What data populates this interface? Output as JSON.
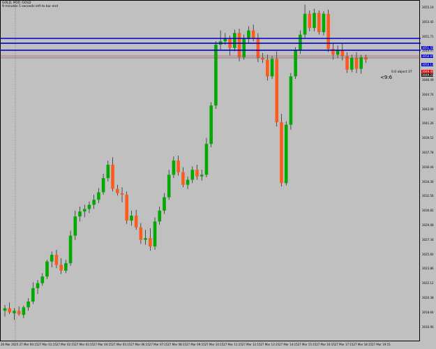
{
  "header": {
    "symbol_line": "GOLD, M10: GOLD",
    "countdown_line": "9 minutes 5 seconds left to bar end"
  },
  "chart_data": {
    "type": "candlestick",
    "instrument": "GOLD",
    "timeframe": "M10",
    "ylim": [
      3015.9,
      3055.4
    ],
    "price_ticks": [
      "3055.19",
      "3053.45",
      "3051.71",
      "3049.97",
      "3048.23",
      "3046.49",
      "3044.74",
      "3043.00",
      "3041.26",
      "3039.52",
      "3037.78",
      "3036.04",
      "3034.30",
      "3032.56",
      "3030.82",
      "3029.08",
      "3027.34",
      "3025.60",
      "3023.86",
      "3022.12",
      "3020.38",
      "3018.64",
      "3016.90"
    ],
    "time_ticks": [
      "26 Mar 2025",
      "27 Mar 00:15",
      "27 Mar 01:15",
      "27 Mar 02:15",
      "27 Mar 03:15",
      "27 Mar 04:15",
      "27 Mar 05:15",
      "27 Mar 06:15",
      "27 Mar 07:15",
      "27 Mar 08:15",
      "27 Mar 09:15",
      "27 Mar 10:15",
      "27 Mar 11:15",
      "27 Mar 12:15",
      "27 Mar 13:15",
      "27 Mar 14:15",
      "27 Mar 15:15",
      "27 Mar 16:15",
      "27 Mar 17:15",
      "27 Mar 18:15",
      "27 Mar 19:15"
    ],
    "candles": [
      [
        3018.9,
        3019.6,
        3018.2,
        3019.2
      ],
      [
        3019.2,
        3019.9,
        3018.5,
        3018.7
      ],
      [
        3018.6,
        3019.2,
        3017.8,
        3018.9
      ],
      [
        3018.9,
        3019.4,
        3018.3,
        3018.5
      ],
      [
        3018.4,
        3019.5,
        3018.0,
        3019.3
      ],
      [
        3019.3,
        3020.4,
        3018.9,
        3020.0
      ],
      [
        3020.0,
        3022.3,
        3019.7,
        3021.6
      ],
      [
        3021.6,
        3022.6,
        3020.9,
        3022.2
      ],
      [
        3022.2,
        3023.4,
        3021.9,
        3023.0
      ],
      [
        3023.0,
        3025.0,
        3022.7,
        3024.8
      ],
      [
        3024.8,
        3026.0,
        3024.1,
        3025.6
      ],
      [
        3025.6,
        3026.2,
        3024.0,
        3024.4
      ],
      [
        3024.4,
        3025.2,
        3023.3,
        3023.7
      ],
      [
        3023.7,
        3025.0,
        3023.4,
        3024.6
      ],
      [
        3024.6,
        3028.5,
        3024.3,
        3027.9
      ],
      [
        3027.9,
        3030.9,
        3027.4,
        3030.2
      ],
      [
        3030.2,
        3031.4,
        3029.6,
        3030.8
      ],
      [
        3030.8,
        3031.6,
        3030.1,
        3031.1
      ],
      [
        3031.1,
        3032.0,
        3030.6,
        3031.6
      ],
      [
        3031.6,
        3032.8,
        3031.1,
        3032.2
      ],
      [
        3032.2,
        3033.6,
        3031.8,
        3033.1
      ],
      [
        3033.1,
        3035.3,
        3032.8,
        3034.8
      ],
      [
        3034.8,
        3036.9,
        3034.4,
        3036.4
      ],
      [
        3036.4,
        3037.3,
        3033.2,
        3033.5
      ],
      [
        3033.5,
        3034.0,
        3032.7,
        3033.0
      ],
      [
        3033.0,
        3033.7,
        3031.9,
        3032.8
      ],
      [
        3032.8,
        3033.2,
        3029.3,
        3029.7
      ],
      [
        3029.7,
        3030.9,
        3029.1,
        3030.3
      ],
      [
        3030.3,
        3031.0,
        3028.6,
        3028.9
      ],
      [
        3028.9,
        3029.4,
        3026.9,
        3027.4
      ],
      [
        3027.4,
        3028.6,
        3026.8,
        3027.6
      ],
      [
        3027.6,
        3028.8,
        3026.1,
        3026.6
      ],
      [
        3026.6,
        3030.1,
        3026.2,
        3029.6
      ],
      [
        3029.6,
        3031.4,
        3029.2,
        3030.9
      ],
      [
        3030.9,
        3033.0,
        3030.5,
        3032.5
      ],
      [
        3032.5,
        3035.8,
        3032.2,
        3035.2
      ],
      [
        3035.2,
        3037.4,
        3034.8,
        3036.9
      ],
      [
        3036.9,
        3037.5,
        3035.1,
        3035.5
      ],
      [
        3035.5,
        3036.1,
        3033.7,
        3034.0
      ],
      [
        3034.0,
        3035.0,
        3033.5,
        3034.6
      ],
      [
        3034.6,
        3036.2,
        3034.2,
        3035.8
      ],
      [
        3035.8,
        3036.4,
        3034.6,
        3035.0
      ],
      [
        3035.0,
        3035.8,
        3034.5,
        3035.2
      ],
      [
        3035.2,
        3039.6,
        3034.9,
        3038.9
      ],
      [
        3038.9,
        3043.9,
        3038.5,
        3043.5
      ],
      [
        3043.5,
        3051.2,
        3043.1,
        3050.8
      ],
      [
        3050.8,
        3052.5,
        3050.2,
        3051.2
      ],
      [
        3051.2,
        3052.2,
        3050.8,
        3051.6
      ],
      [
        3051.6,
        3051.9,
        3049.5,
        3050.4
      ],
      [
        3050.4,
        3052.6,
        3050.0,
        3052.2
      ],
      [
        3052.2,
        3052.7,
        3048.8,
        3049.3
      ],
      [
        3049.3,
        3052.0,
        3049.0,
        3051.5
      ],
      [
        3051.5,
        3053.0,
        3051.0,
        3052.5
      ],
      [
        3052.5,
        3053.2,
        3051.2,
        3051.6
      ],
      [
        3051.6,
        3052.2,
        3048.7,
        3049.2
      ],
      [
        3049.2,
        3049.8,
        3048.6,
        3049.0
      ],
      [
        3049.0,
        3049.6,
        3046.5,
        3047.0
      ],
      [
        3047.0,
        3049.5,
        3046.7,
        3049.1
      ],
      [
        3049.1,
        3050.0,
        3041.0,
        3041.5
      ],
      [
        3041.5,
        3042.5,
        3033.8,
        3034.2
      ],
      [
        3034.2,
        3041.6,
        3033.9,
        3041.2
      ],
      [
        3041.2,
        3047.4,
        3040.6,
        3047.0
      ],
      [
        3047.0,
        3050.5,
        3046.7,
        3050.1
      ],
      [
        3050.1,
        3052.5,
        3049.7,
        3052.0
      ],
      [
        3052.0,
        3055.6,
        3051.6,
        3054.5
      ],
      [
        3054.5,
        3054.9,
        3052.4,
        3052.8
      ],
      [
        3052.8,
        3055.1,
        3052.4,
        3054.6
      ],
      [
        3054.6,
        3054.9,
        3052.0,
        3052.3
      ],
      [
        3052.3,
        3054.8,
        3051.9,
        3054.5
      ],
      [
        3054.5,
        3055.0,
        3049.9,
        3050.3
      ],
      [
        3050.3,
        3051.0,
        3049.0,
        3049.6
      ],
      [
        3049.6,
        3050.7,
        3049.2,
        3050.2
      ],
      [
        3050.2,
        3051.0,
        3048.9,
        3049.4
      ],
      [
        3049.4,
        3049.9,
        3047.4,
        3047.8
      ],
      [
        3047.8,
        3049.6,
        3047.5,
        3049.2
      ],
      [
        3049.2,
        3049.9,
        3047.4,
        3047.9
      ],
      [
        3047.9,
        3049.6,
        3047.3,
        3049.3
      ],
      [
        3049.3,
        3049.6,
        3048.6,
        3049.0
      ]
    ]
  },
  "lines": {
    "hlines": [
      3051.55,
      3050.97,
      3050.13
    ],
    "prev_close_line": 3049.45,
    "ask_line": 3049.21,
    "vline_label": "vertical period separator"
  },
  "labels": {
    "line1": "3051.55",
    "line2": "3050.97",
    "line3": "3050.13",
    "bid_red": "3049.45",
    "bid_dark": "3049.21",
    "object_label": "0.0 object 37",
    "cursor_readout": "<9:6"
  },
  "colors": {
    "bull": "#00aa00",
    "bear": "#ff5a1e",
    "hline": "#0000cc",
    "bg": "#c0c0c0"
  }
}
